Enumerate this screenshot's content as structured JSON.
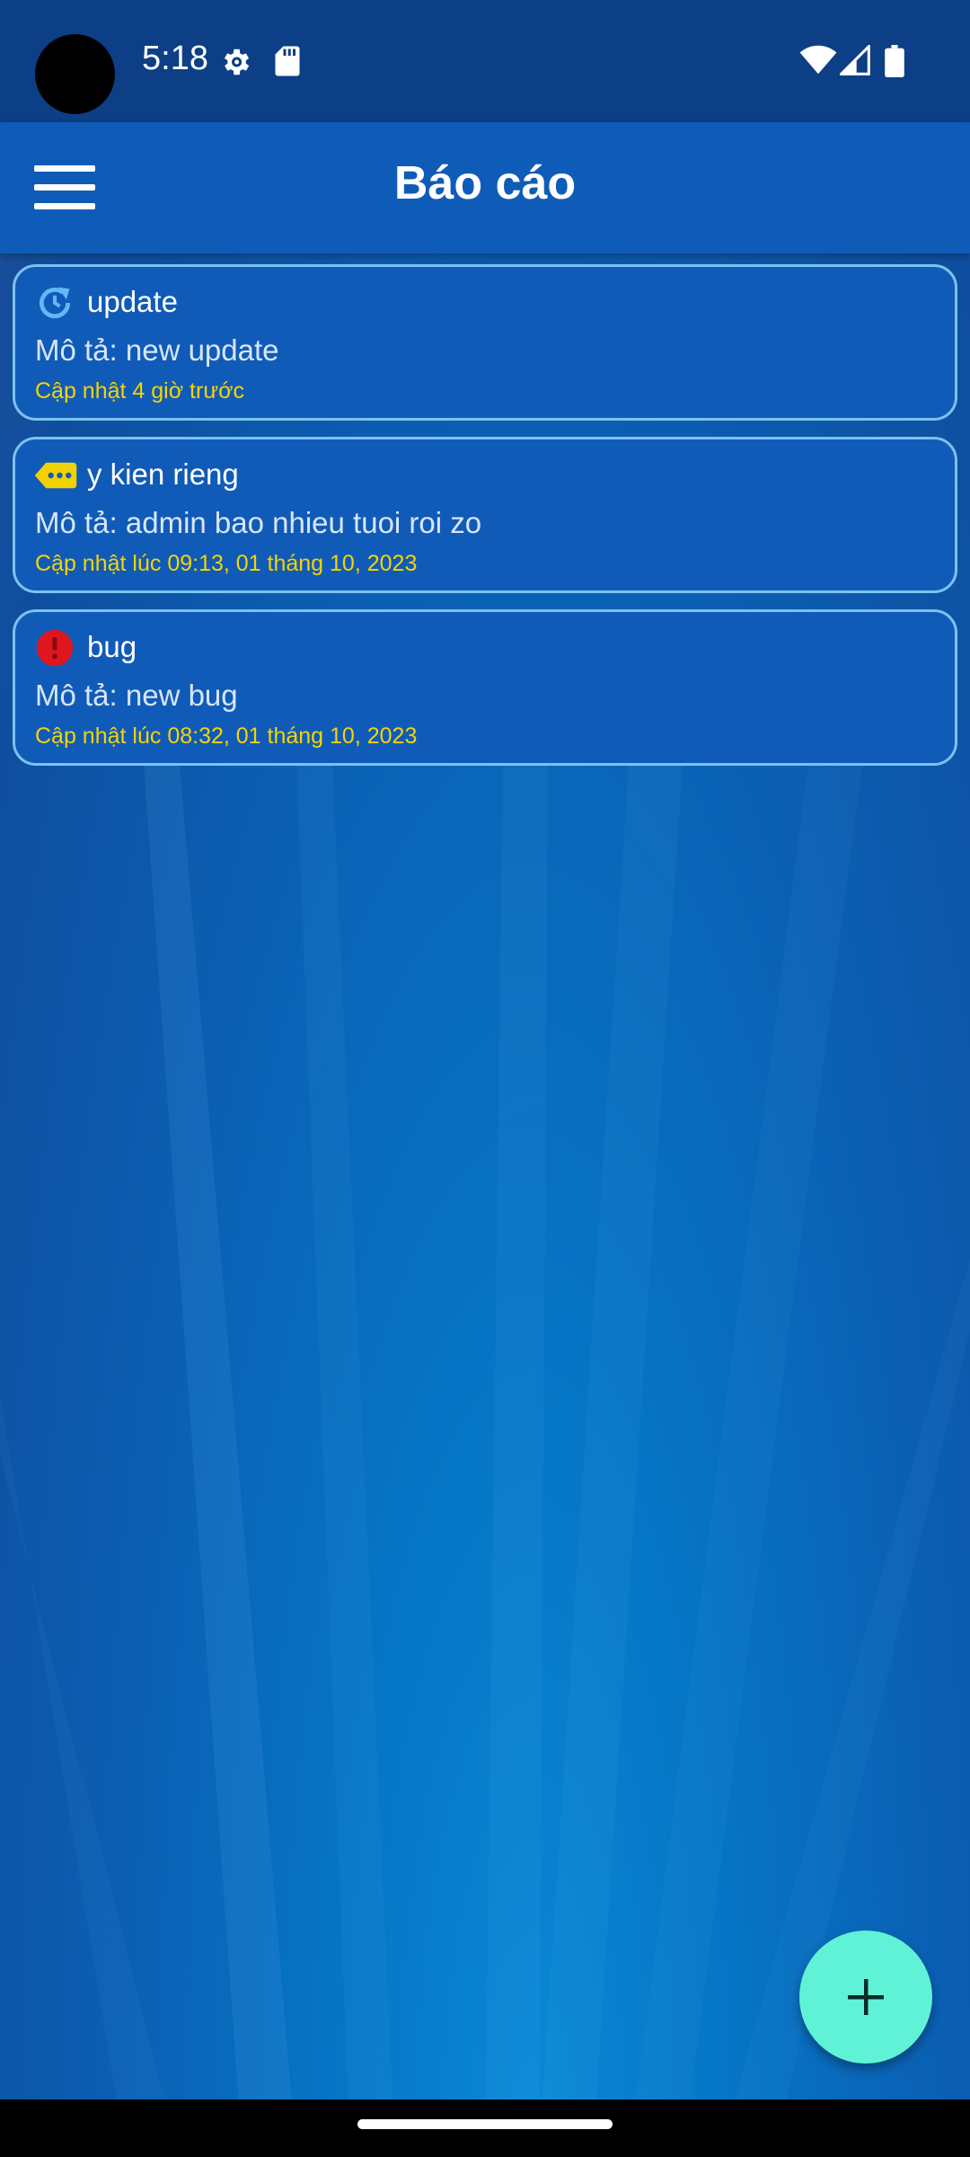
{
  "status_bar": {
    "time": "5:18",
    "icons": [
      "settings-icon",
      "sd-card-icon",
      "wifi-icon",
      "cellular-signal-icon",
      "battery-icon"
    ]
  },
  "app_bar": {
    "title": "Báo cáo",
    "menu_icon": "hamburger-menu-icon"
  },
  "reports": [
    {
      "icon": "refresh-icon",
      "icon_color": "#5fb9f5",
      "title": "update",
      "description": "Mô tả: new update",
      "updated": "Cập nhật 4 giờ trước"
    },
    {
      "icon": "feedback-tag-icon",
      "icon_color": "#f2d100",
      "title": "y kien rieng",
      "description": "Mô tả: admin bao nhieu tuoi roi zo",
      "updated": "Cập nhật lúc 09:13, 01 tháng 10, 2023"
    },
    {
      "icon": "error-icon",
      "icon_color": "#e0161e",
      "title": "bug",
      "description": "Mô tả: new bug",
      "updated": "Cập nhật lúc 08:32, 01 tháng 10, 2023"
    }
  ],
  "fab": {
    "icon": "plus-icon",
    "color": "#5ff2d6"
  },
  "colors": {
    "status_bar": "#0d3f86",
    "app_bar": "#0f5cb8",
    "card_background": "#115bb8",
    "card_border": "#7cc2f0",
    "timestamp_text": "#f5d400"
  }
}
